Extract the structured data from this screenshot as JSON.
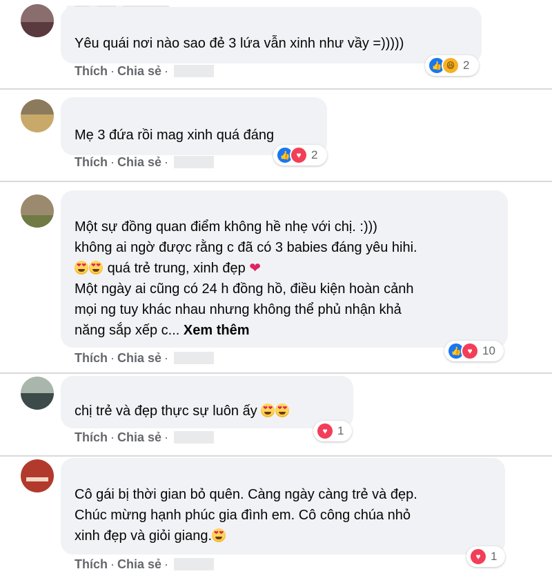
{
  "colors": {
    "bubble_bg": "#f0f2f5",
    "action_text": "#65676b",
    "like": "#1877f2",
    "love": "#f33e58",
    "haha": "#f7b125"
  },
  "actions": {
    "like": "Thích",
    "share": "Chia sẻ",
    "separator": "·"
  },
  "comments": [
    {
      "lines": [
        "Yêu quái nơi nào sao đẻ 3 lứa vẫn xinh như vầy =)))))"
      ],
      "reactions": {
        "icons": [
          "like-icon",
          "haha-icon"
        ],
        "count": "2"
      }
    },
    {
      "lines": [
        "Mẹ 3 đứa rồi mag xinh quá đáng"
      ],
      "reactions": {
        "icons": [
          "like-icon",
          "love-icon"
        ],
        "count": "2"
      }
    },
    {
      "lines": [
        "Một sự đồng quan điểm không hề nhẹ với chị. :)))",
        "không ai ngờ được rằng c đã có 3 babies đáng yêu hihi.",
        "quá trẻ trung, xinh đẹp",
        "Một ngày ai cũng có 24 h đồng hồ, điều kiện hoàn cảnh",
        "mọi ng tuy khác nhau nhưng không thể phủ nhận khả",
        "năng sắp xếp c..."
      ],
      "see_more": "Xem thêm",
      "reactions": {
        "icons": [
          "like-icon",
          "love-icon"
        ],
        "count": "10"
      }
    },
    {
      "lines": [
        "chị trẻ và đẹp thực sự luôn ấy"
      ],
      "reactions": {
        "icons": [
          "love-icon"
        ],
        "count": "1"
      }
    },
    {
      "lines": [
        "Cô gái bị thời gian bỏ quên. Càng ngày càng trẻ và đẹp.",
        "Chúc mừng hạnh phúc gia đình em. Cô công chúa nhỏ",
        "xinh đẹp và giỏi giang."
      ],
      "reactions": {
        "icons": [
          "love-icon"
        ],
        "count": "1"
      }
    }
  ]
}
